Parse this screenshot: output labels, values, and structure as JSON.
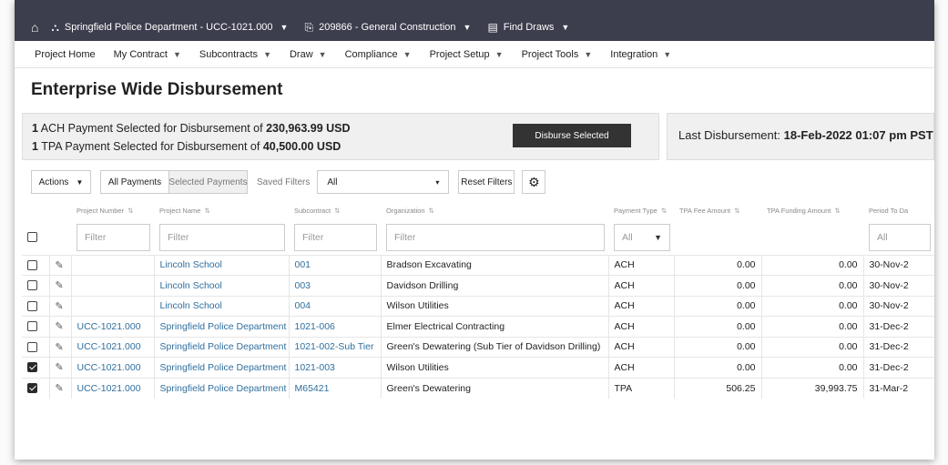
{
  "topbar": {
    "project": "Springfield Police Department - UCC-1021.000",
    "contract": "209866 - General Construction",
    "find": "Find Draws"
  },
  "menu": [
    "Project Home",
    "My Contract",
    "Subcontracts",
    "Draw",
    "Compliance",
    "Project Setup",
    "Project Tools",
    "Integration"
  ],
  "page_title": "Enterprise Wide Disbursement",
  "summary": {
    "ach_count": "1",
    "ach_text": "ACH Payment Selected for Disbursement of",
    "ach_amount": "230,963.99 USD",
    "tpa_count": "1",
    "tpa_text": "TPA Payment Selected for Disbursement of",
    "tpa_amount": "40,500.00 USD",
    "disburse_label": "Disburse Selected"
  },
  "last": {
    "label": "Last Disbursement:",
    "value": "18-Feb-2022 01:07 pm PST"
  },
  "filters": {
    "actions_label": "Actions",
    "all_payments": "All Payments",
    "selected_payments": "Selected Payments",
    "saved_label": "Saved Filters",
    "saved_value": "All",
    "reset_label": "Reset Filters"
  },
  "columns": [
    "Project Number",
    "Project Name",
    "Subcontract",
    "Organization",
    "Payment Type",
    "TPA Fee Amount",
    "TPA Funding Amount",
    "Period To Da"
  ],
  "filter_row": {
    "placeholder": "Filter",
    "payment_type": "All",
    "period": "All"
  },
  "rows": [
    {
      "checked": false,
      "project_number": "",
      "project_name": "Lincoln School",
      "subcontract": "001",
      "organization": "Bradson Excavating",
      "payment_type": "ACH",
      "tpa_fee": "0.00",
      "tpa_funding": "0.00",
      "period": "30-Nov-2"
    },
    {
      "checked": false,
      "project_number": "",
      "project_name": "Lincoln School",
      "subcontract": "003",
      "organization": "Davidson Drilling",
      "payment_type": "ACH",
      "tpa_fee": "0.00",
      "tpa_funding": "0.00",
      "period": "30-Nov-2"
    },
    {
      "checked": false,
      "project_number": "",
      "project_name": "Lincoln School",
      "subcontract": "004",
      "organization": "Wilson Utilities",
      "payment_type": "ACH",
      "tpa_fee": "0.00",
      "tpa_funding": "0.00",
      "period": "30-Nov-2"
    },
    {
      "checked": false,
      "project_number": "UCC-1021.000",
      "project_name": "Springfield Police Department",
      "subcontract": "1021-006",
      "organization": "Elmer Electrical Contracting",
      "payment_type": "ACH",
      "tpa_fee": "0.00",
      "tpa_funding": "0.00",
      "period": "31-Dec-2"
    },
    {
      "checked": false,
      "project_number": "UCC-1021.000",
      "project_name": "Springfield Police Department",
      "subcontract": "1021-002-Sub Tier",
      "organization": "Green's Dewatering (Sub Tier of Davidson Drilling)",
      "payment_type": "ACH",
      "tpa_fee": "0.00",
      "tpa_funding": "0.00",
      "period": "31-Dec-2"
    },
    {
      "checked": true,
      "project_number": "UCC-1021.000",
      "project_name": "Springfield Police Department",
      "subcontract": "1021-003",
      "organization": "Wilson Utilities",
      "payment_type": "ACH",
      "tpa_fee": "0.00",
      "tpa_funding": "0.00",
      "period": "31-Dec-2"
    },
    {
      "checked": true,
      "project_number": "UCC-1021.000",
      "project_name": "Springfield Police Department",
      "subcontract": "M65421",
      "organization": "Green's Dewatering",
      "payment_type": "TPA",
      "tpa_fee": "506.25",
      "tpa_funding": "39,993.75",
      "period": "31-Mar-2"
    }
  ]
}
